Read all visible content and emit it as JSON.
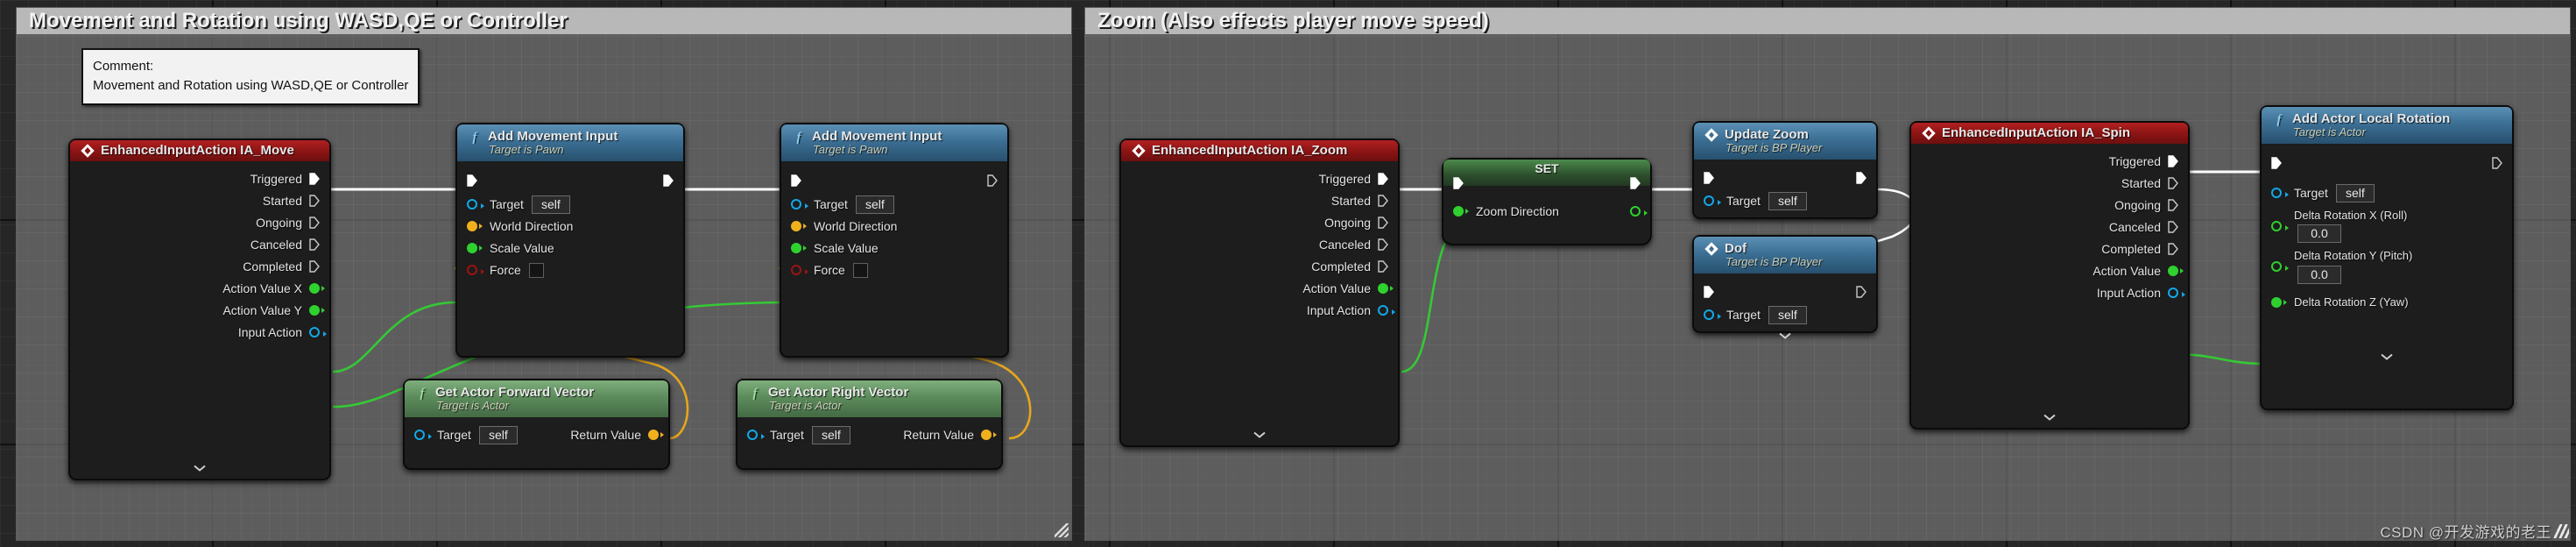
{
  "editor": {
    "watermark": "CSDN @开发游戏的老王"
  },
  "comments": [
    {
      "id": "movement",
      "title": "Movement and Rotation using WASD,QE or Controller"
    },
    {
      "id": "zoom",
      "title": "Zoom (Also effects player move speed)"
    }
  ],
  "tooltip": {
    "line1": "Comment:",
    "line2": "Movement and Rotation using WASD,QE or Controller"
  },
  "nodes": {
    "ia_move": {
      "title": "EnhancedInputAction IA_Move",
      "icon": "event-diamond-icon",
      "pins": [
        {
          "label": "Triggered",
          "kind": "exec",
          "filled": true
        },
        {
          "label": "Started",
          "kind": "exec",
          "filled": false
        },
        {
          "label": "Ongoing",
          "kind": "exec",
          "filled": false
        },
        {
          "label": "Canceled",
          "kind": "exec",
          "filled": false
        },
        {
          "label": "Completed",
          "kind": "exec",
          "filled": false
        },
        {
          "label": "Action Value X",
          "kind": "data",
          "color": "green",
          "filled": true
        },
        {
          "label": "Action Value Y",
          "kind": "data",
          "color": "green",
          "filled": true
        },
        {
          "label": "Input Action",
          "kind": "data",
          "color": "blue",
          "filled": false
        }
      ],
      "expander": "chevron-down-icon"
    },
    "add_movement_input_1": {
      "title": "Add Movement Input",
      "subtitle": "Target is Pawn",
      "icon": "function-f-icon",
      "inputs": [
        {
          "label": "Target",
          "color": "blue",
          "filled": false,
          "value": "self"
        },
        {
          "label": "World Direction",
          "color": "yellow",
          "filled": true
        },
        {
          "label": "Scale Value",
          "color": "green",
          "filled": true
        },
        {
          "label": "Force",
          "color": "red",
          "filled": false,
          "checkbox": true
        }
      ]
    },
    "add_movement_input_2": {
      "title": "Add Movement Input",
      "subtitle": "Target is Pawn",
      "icon": "function-f-icon",
      "inputs": [
        {
          "label": "Target",
          "color": "blue",
          "filled": false,
          "value": "self"
        },
        {
          "label": "World Direction",
          "color": "yellow",
          "filled": true
        },
        {
          "label": "Scale Value",
          "color": "green",
          "filled": true
        },
        {
          "label": "Force",
          "color": "red",
          "filled": false,
          "checkbox": true
        }
      ]
    },
    "get_actor_forward_vector": {
      "title": "Get Actor Forward Vector",
      "subtitle": "Target is Actor",
      "icon": "function-f-icon",
      "target_label": "Target",
      "target_value": "self",
      "return_label": "Return Value"
    },
    "get_actor_right_vector": {
      "title": "Get Actor Right Vector",
      "subtitle": "Target is Actor",
      "icon": "function-f-icon",
      "target_label": "Target",
      "target_value": "self",
      "return_label": "Return Value"
    },
    "ia_zoom": {
      "title": "EnhancedInputAction IA_Zoom",
      "icon": "event-diamond-icon",
      "pins": [
        {
          "label": "Triggered",
          "kind": "exec",
          "filled": true
        },
        {
          "label": "Started",
          "kind": "exec",
          "filled": false
        },
        {
          "label": "Ongoing",
          "kind": "exec",
          "filled": false
        },
        {
          "label": "Canceled",
          "kind": "exec",
          "filled": false
        },
        {
          "label": "Completed",
          "kind": "exec",
          "filled": false
        },
        {
          "label": "Action Value",
          "kind": "data",
          "color": "green",
          "filled": true
        },
        {
          "label": "Input Action",
          "kind": "data",
          "color": "blue",
          "filled": false
        }
      ],
      "expander": "chevron-down-icon"
    },
    "set_zoom_direction": {
      "title": "SET",
      "variable_label": "Zoom Direction"
    },
    "update_zoom": {
      "title": "Update Zoom",
      "subtitle": "Target is BP Player",
      "icon": "event-diamond-icon",
      "target_label": "Target",
      "target_value": "self"
    },
    "dof": {
      "title": "Dof",
      "subtitle": "Target is BP Player",
      "icon": "event-diamond-icon",
      "target_label": "Target",
      "target_value": "self"
    },
    "ia_spin": {
      "title": "EnhancedInputAction IA_Spin",
      "icon": "event-diamond-icon",
      "pins": [
        {
          "label": "Triggered",
          "kind": "exec",
          "filled": true
        },
        {
          "label": "Started",
          "kind": "exec",
          "filled": false
        },
        {
          "label": "Ongoing",
          "kind": "exec",
          "filled": false
        },
        {
          "label": "Canceled",
          "kind": "exec",
          "filled": false
        },
        {
          "label": "Completed",
          "kind": "exec",
          "filled": false
        },
        {
          "label": "Action Value",
          "kind": "data",
          "color": "green",
          "filled": true
        },
        {
          "label": "Input Action",
          "kind": "data",
          "color": "blue",
          "filled": false
        }
      ],
      "expander": "chevron-down-icon"
    },
    "add_actor_local_rotation": {
      "title": "Add Actor Local Rotation",
      "subtitle": "Target is Actor",
      "icon": "function-f-icon",
      "inputs": [
        {
          "label": "Target",
          "color": "blue",
          "filled": false,
          "value": "self"
        },
        {
          "label": "Delta Rotation X (Roll)",
          "color": "green",
          "filled": false,
          "value": "0.0"
        },
        {
          "label": "Delta Rotation Y (Pitch)",
          "color": "green",
          "filled": false,
          "value": "0.0"
        },
        {
          "label": "Delta Rotation Z (Yaw)",
          "color": "green",
          "filled": true
        }
      ],
      "expander": "chevron-down-icon"
    }
  },
  "colors": {
    "exec_white": "#ffffff",
    "data_green": "#2fd12f",
    "data_yellow": "#f0b01e",
    "data_blue": "#12a8e8",
    "data_red": "#9b1414",
    "event_red_header": "#8a1414",
    "function_blue_header": "#3c6f94",
    "pure_green_header": "#5d8c5c",
    "set_green_header": "#2c4e2c",
    "comment_fill": "#808080",
    "canvas_bg": "#262626"
  }
}
